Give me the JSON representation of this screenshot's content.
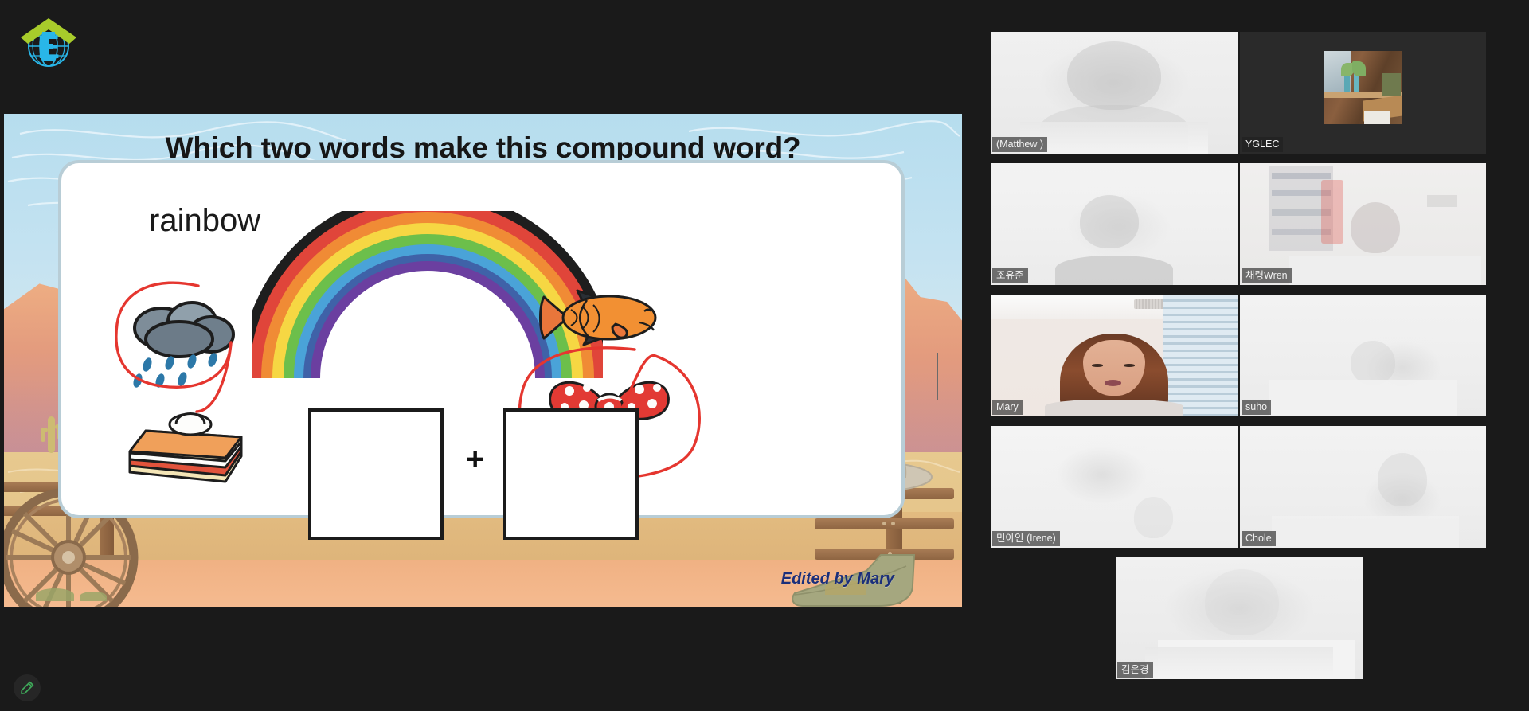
{
  "app": {
    "background_color": "#1a1a1a",
    "logo": {
      "name": "yglec-logo",
      "letter": "E",
      "arrow_color": "#a8cc2b",
      "globe_color": "#29b6e8"
    }
  },
  "toolbar": {
    "annotate_button_label": "Annotate",
    "annotate_icon": "pencil-icon",
    "annotate_icon_color": "#3faa5a"
  },
  "shared_screen": {
    "slide_title": "Which two words make this compound word?",
    "compound_word": "rainbow",
    "plus_sign": "+",
    "credit": "Edited by Mary",
    "theme": "western-desert",
    "answer_box_left_value": "",
    "answer_box_right_value": "",
    "picture_choices": [
      {
        "name": "rain-cloud-image",
        "label": "rain cloud",
        "circled": true
      },
      {
        "name": "cake-slice-image",
        "label": "cake slice",
        "circled": false
      },
      {
        "name": "fish-image",
        "label": "fish",
        "circled": false
      },
      {
        "name": "bow-image",
        "label": "bow",
        "circled": true
      }
    ],
    "annotation_color": "#e5362f",
    "rainbow_colors": [
      "#e0453a",
      "#f08b35",
      "#f6d743",
      "#6cbf4b",
      "#4aa3d8",
      "#3f62a8",
      "#6b3fa0"
    ]
  },
  "participants": [
    {
      "name": "(Matthew )",
      "tile": "participant-tile-matthew",
      "feed": "blown",
      "active": false
    },
    {
      "name": "YGLEC",
      "tile": "participant-tile-yglec",
      "feed": "dark-room",
      "active": false
    },
    {
      "name": "조유준",
      "tile": "participant-tile-jo-yujun",
      "feed": "blown2",
      "active": false
    },
    {
      "name": "채령Wren",
      "tile": "participant-tile-chaeryeong-wren",
      "feed": "bookshelf",
      "active": true
    },
    {
      "name": "Mary",
      "tile": "participant-tile-mary",
      "feed": "mary",
      "active": false
    },
    {
      "name": "suho",
      "tile": "participant-tile-suho",
      "feed": "blown3",
      "active": false
    },
    {
      "name": "민아인 (Irene)",
      "tile": "participant-tile-irene",
      "feed": "blown4",
      "active": false
    },
    {
      "name": "Chole",
      "tile": "participant-tile-chole",
      "feed": "blown3",
      "active": false
    },
    {
      "name": "김은경",
      "tile": "participant-tile-kim-eunkyung",
      "feed": "blown",
      "active": false
    }
  ],
  "active_speaker_border_color": "#c9e265"
}
